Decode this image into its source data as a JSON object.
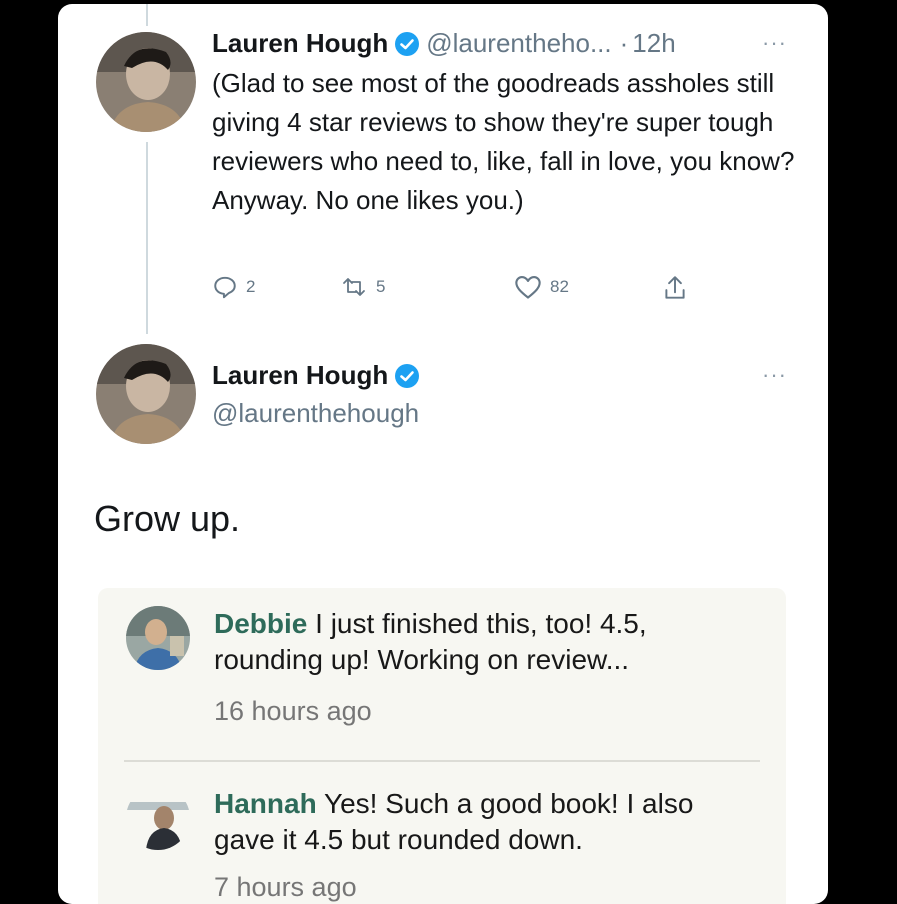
{
  "tweet1": {
    "name": "Lauren Hough",
    "handle": "@laurentheho...",
    "time_sep": "·",
    "time": "12h",
    "more": "···",
    "text": "(Glad to see most of the goodreads assholes still giving 4 star reviews to show they're super tough reviewers who need to, like, fall in love, you know? Anyway. No one likes you.)",
    "replies": "2",
    "retweets": "5",
    "likes": "82"
  },
  "tweet2": {
    "name": "Lauren Hough",
    "handle": "@laurenthehough",
    "more": "···",
    "text": "Grow up."
  },
  "comments": [
    {
      "name": "Debbie",
      "text": " I just finished this, too! 4.5, rounding up! Working on review...",
      "time": "16 hours ago"
    },
    {
      "name": "Hannah",
      "text": " Yes! Such a good book! I also gave it 4.5 but rounded down.",
      "time": "7 hours ago"
    }
  ],
  "icons": {
    "verified": "verified-badge-icon",
    "reply": "reply-bubble-icon",
    "retweet": "retweet-icon",
    "like": "heart-icon",
    "share": "share-upload-icon"
  },
  "colors": {
    "verified_blue": "#1da1f2",
    "commenter_green": "#2e6b5a",
    "muted": "#657786"
  }
}
